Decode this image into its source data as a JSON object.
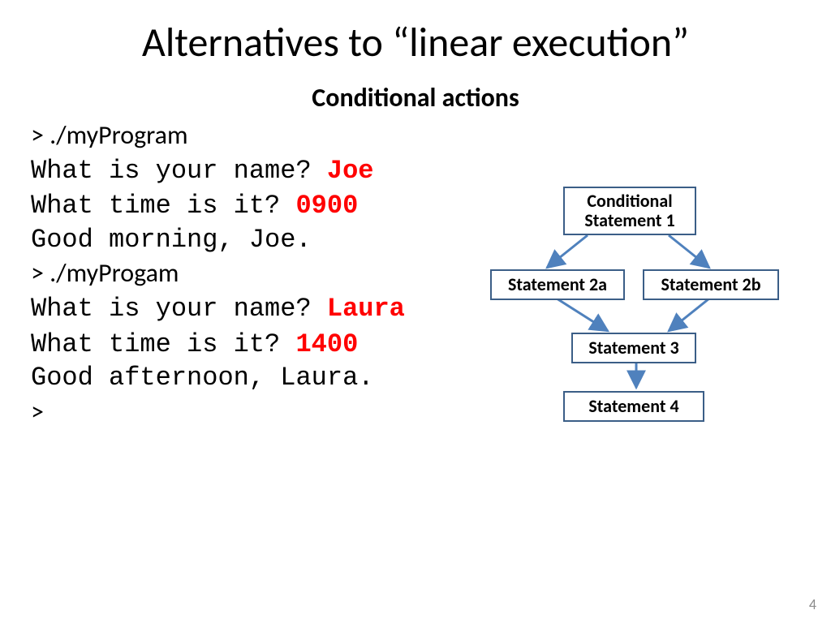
{
  "title": "Alternatives to “linear execution”",
  "subtitle": "Conditional actions",
  "lines": {
    "l1_prompt": "> ",
    "l1_cmd": "./myProgram",
    "l2_q": "What is your name? ",
    "l2_a": "Joe",
    "l3_q": "What time is it? ",
    "l3_a": "0900",
    "l4": "Good morning, Joe.",
    "l5_prompt": "> ",
    "l5_cmd": "./myProgam",
    "l6_q": "What is your name? ",
    "l6_a": "Laura",
    "l7_q": "What time is it? ",
    "l7_a": "1400",
    "l8": "Good afternoon, Laura.",
    "l9": ">"
  },
  "diagram": {
    "box1_l1": "Conditional",
    "box1_l2": "Statement 1",
    "box2a": "Statement 2a",
    "box2b": "Statement 2b",
    "box3": "Statement 3",
    "box4": "Statement 4"
  },
  "pagenum": "4",
  "colors": {
    "box_border": "#3b5e87",
    "arrow": "#4f81bd",
    "user_input": "#ff0000"
  }
}
